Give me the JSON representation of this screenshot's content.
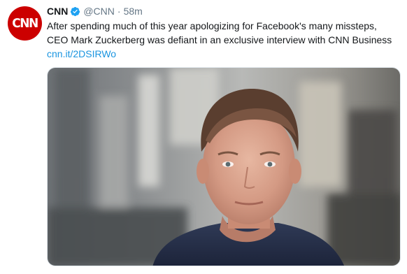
{
  "tweet": {
    "avatar": {
      "logo_text": "CNN",
      "color": "#cc0000"
    },
    "author": {
      "display_name": "CNN",
      "verified_icon": "verified-badge-icon",
      "handle": "@CNN",
      "separator": "·",
      "timestamp": "58m"
    },
    "text": "After spending much of this year apologizing for Facebook's many missteps, CEO Mark Zuckerberg was defiant in an exclusive interview with CNN Business",
    "link": "cnn.it/2DSIRWo",
    "colors": {
      "text": "#14171a",
      "secondary": "#657786",
      "link": "#1b95e0",
      "verified": "#1da1f2"
    }
  }
}
